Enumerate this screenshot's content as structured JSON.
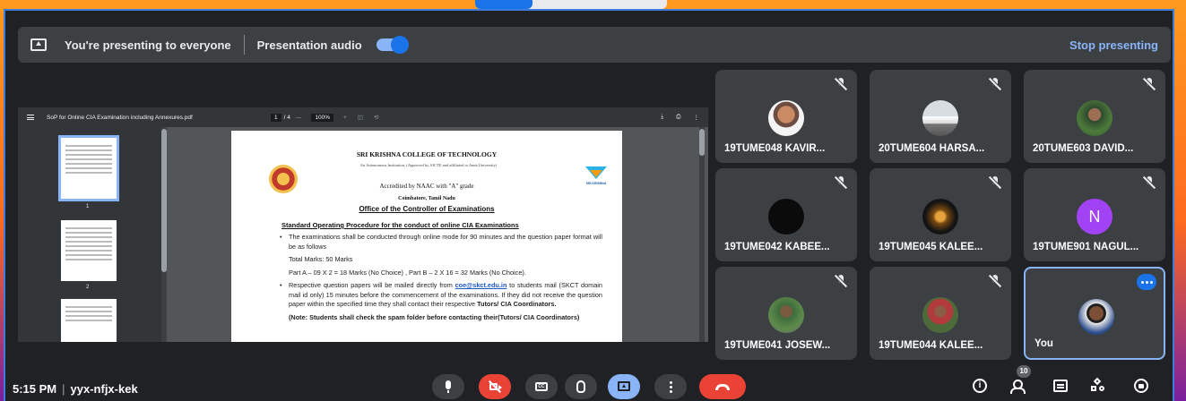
{
  "presenting_bar": {
    "status_text": "You're presenting to everyone",
    "audio_label": "Presentation audio",
    "audio_enabled": true,
    "stop_label": "Stop presenting"
  },
  "pdf_viewer": {
    "filename": "SoP for Online CIA Examination including Annexures.pdf",
    "page_current": "1",
    "page_total": "/ 4",
    "zoom": "100%",
    "zoom_out": "—",
    "zoom_in": "+",
    "thumbnails": [
      "1",
      "2"
    ],
    "document": {
      "college": "SRI KRISHNA COLLEGE OF TECHNOLOGY",
      "affiliation": "An Autonomous Institution, (Approved by AICTE and affiliated to Anna University)",
      "accreditation": "Accredited by NAAC with \"A\" grade",
      "city": "Coimbatore, Tamil Nadu",
      "office": "Office of the Controller of Examinations",
      "logo_label": "SRI KRISHNA",
      "heading": "Standard Operating Procedure for the conduct of online CIA Examinations",
      "p1": "The examinations shall be conducted through online mode for 90 minutes and the question paper format will be as follows",
      "p2": "Total Marks: 50 Marks",
      "p3": "Part A – 09 X 2 = 18 Marks (No Choice) , Part B – 2 X 16 = 32 Marks (No Choice).",
      "p4_a": "Respective question papers will be mailed directly from ",
      "p4_link": "coe@skct.edu.in",
      "p4_b": " to students mail (SKCT domain mail id only) 15 minutes before the commencement of the examinations. If they did not receive the question paper within the specified time they shall contact their respective ",
      "p4_bold": "Tutors/ CIA Coordinators.",
      "p5": "(Note: Students shall check the spam folder before contacting their(Tutors/ CIA Coordinators)"
    }
  },
  "participants": [
    {
      "name": "19TUME048 KAVIR...",
      "muted": true
    },
    {
      "name": "20TUME604 HARSA...",
      "muted": true
    },
    {
      "name": "20TUME603 DAVID...",
      "muted": true
    },
    {
      "name": "19TUME042 KABEE...",
      "muted": true
    },
    {
      "name": "19TUME045 KALEE...",
      "muted": true
    },
    {
      "name": "19TUME901 NAGUL...",
      "muted": true,
      "initial": "N"
    },
    {
      "name": "19TUME041 JOSEW...",
      "muted": true
    },
    {
      "name": "19TUME044 KALEE...",
      "muted": true
    },
    {
      "name": "You",
      "muted": false
    }
  ],
  "bottom_bar": {
    "time": "5:15 PM",
    "separator": "|",
    "meeting_code": "yyx-nfjx-kek",
    "people_count": "10",
    "cc_label": "CC"
  },
  "colors": {
    "background": "#202124",
    "tile": "#3c4043",
    "accent": "#8ab4f8",
    "danger": "#ea4335"
  }
}
